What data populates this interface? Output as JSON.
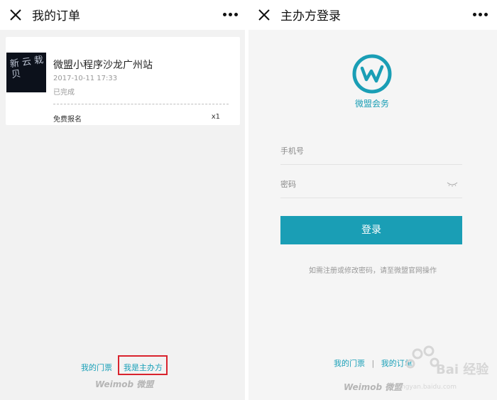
{
  "left": {
    "nav_title": "我的订单",
    "order": {
      "thumb_text": "新 云 栽 贝",
      "title": "微盟小程序沙龙广州站",
      "time": "2017-10-11 17:33",
      "status": "已完成",
      "ticket_name": "免费报名",
      "ticket_qty": "x1"
    },
    "footer": {
      "my_tickets": "我的门票",
      "i_am_organizer": "我是主办方"
    },
    "brand": "Weimob 微盟"
  },
  "right": {
    "nav_title": "主办方登录",
    "logo_text": "微盟会务",
    "phone_placeholder": "手机号",
    "password_placeholder": "密码",
    "login_label": "登录",
    "hint": "如需注册或修改密码，请至微盟官网操作",
    "footer": {
      "my_tickets": "我的门票",
      "separator": "|",
      "my_orders": "我的订单"
    },
    "brand": "Weimob 微盟"
  },
  "watermark": {
    "text": "Bai 经验",
    "sub": "jingyan.baidu.com"
  },
  "colors": {
    "accent": "#1a9eb5",
    "highlight": "#d9232d",
    "background": "#f2f2f2"
  },
  "icons": [
    "close-icon",
    "more-icon",
    "logo-icon",
    "eye-icon"
  ]
}
